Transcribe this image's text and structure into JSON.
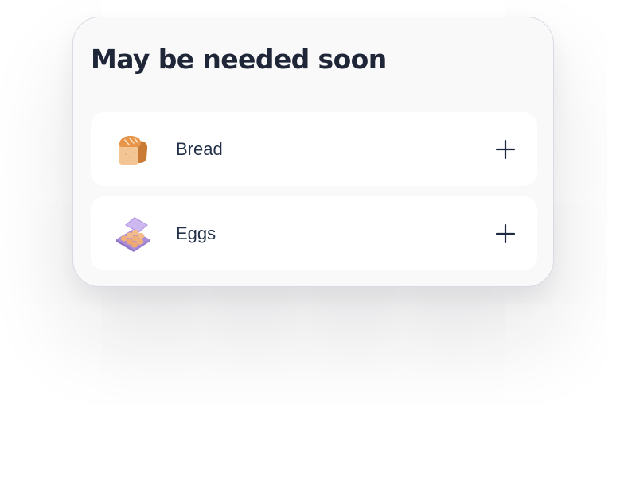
{
  "card": {
    "title": "May be needed soon"
  },
  "items": [
    {
      "label": "Bread",
      "icon": "bread-icon",
      "action": "plus-icon"
    },
    {
      "label": "Eggs",
      "icon": "egg-carton-icon",
      "action": "plus-icon"
    }
  ],
  "colors": {
    "title": "#1e2637",
    "label": "#223049",
    "card_bg": "#f9f9fa",
    "item_bg": "#ffffff",
    "bread": "#e6954a",
    "carton": "#a98bd8",
    "egg": "#f0b07a"
  }
}
